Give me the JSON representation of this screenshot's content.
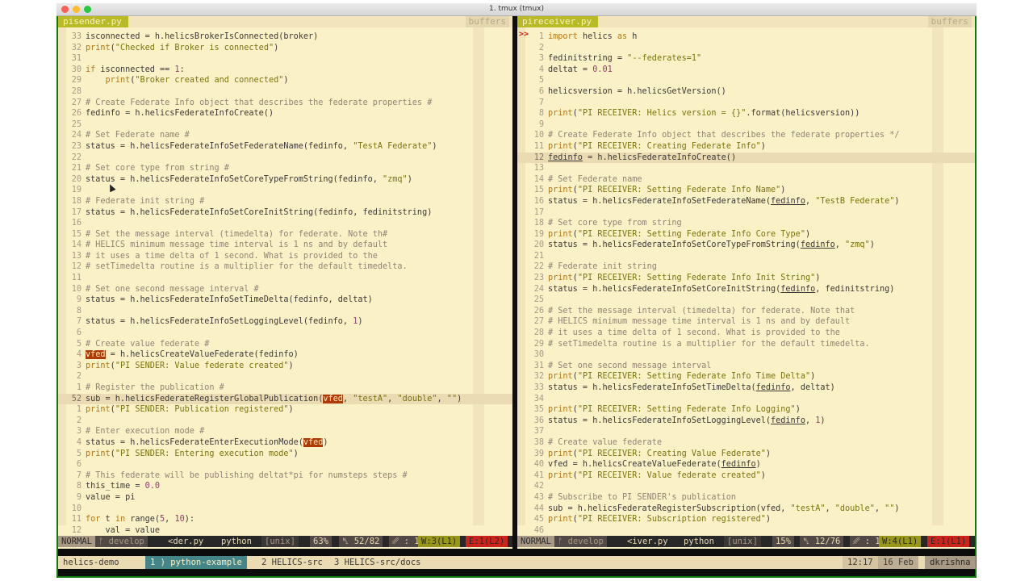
{
  "window": {
    "title": "1. tmux (tmux)"
  },
  "left_pane": {
    "file_tab": "pisender.py",
    "buffers_label": "buffers",
    "lines": [
      {
        "n": "33",
        "t": "isconnected = h.helicsBrokerIsConnected(broker)"
      },
      {
        "n": "32",
        "t": "print(\"Checked if Broker is connected\")"
      },
      {
        "n": "31",
        "t": ""
      },
      {
        "n": "30",
        "t": "if isconnected == 1:"
      },
      {
        "n": "29",
        "t": "    print(\"Broker created and connected\")"
      },
      {
        "n": "28",
        "t": ""
      },
      {
        "n": "27",
        "t": "# Create Federate Info object that describes the federate properties #"
      },
      {
        "n": "26",
        "t": "fedinfo = h.helicsFederateInfoCreate()"
      },
      {
        "n": "25",
        "t": ""
      },
      {
        "n": "24",
        "t": "# Set Federate name #"
      },
      {
        "n": "23",
        "t": "status = h.helicsFederateInfoSetFederateName(fedinfo, \"TestA Federate\")"
      },
      {
        "n": "22",
        "t": ""
      },
      {
        "n": "21",
        "t": "# Set core type from string #"
      },
      {
        "n": "20",
        "t": "status = h.helicsFederateInfoSetCoreTypeFromString(fedinfo, \"zmq\")"
      },
      {
        "n": "19",
        "t": ""
      },
      {
        "n": "18",
        "t": "# Federate init string #"
      },
      {
        "n": "17",
        "t": "status = h.helicsFederateInfoSetCoreInitString(fedinfo, fedinitstring)"
      },
      {
        "n": "16",
        "t": ""
      },
      {
        "n": "15",
        "t": "# Set the message interval (timedelta) for federate. Note th#"
      },
      {
        "n": "14",
        "t": "# HELICS minimum message time interval is 1 ns and by default"
      },
      {
        "n": "13",
        "t": "# it uses a time delta of 1 second. What is provided to the"
      },
      {
        "n": "12",
        "t": "# setTimedelta routine is a multiplier for the default timedelta."
      },
      {
        "n": "11",
        "t": ""
      },
      {
        "n": "10",
        "t": "# Set one second message interval #"
      },
      {
        "n": "9",
        "t": "status = h.helicsFederateInfoSetTimeDelta(fedinfo, deltat)"
      },
      {
        "n": "8",
        "t": ""
      },
      {
        "n": "7",
        "t": "status = h.helicsFederateInfoSetLoggingLevel(fedinfo, 1)"
      },
      {
        "n": "6",
        "t": ""
      },
      {
        "n": "5",
        "t": "# Create value federate #"
      },
      {
        "n": "4",
        "t": "vfed = h.helicsCreateValueFederate(fedinfo)"
      },
      {
        "n": "3",
        "t": "print(\"PI SENDER: Value federate created\")"
      },
      {
        "n": "2",
        "t": ""
      },
      {
        "n": "1",
        "t": "# Register the publication #"
      },
      {
        "n": "52",
        "t": "sub = h.helicsFederateRegisterGlobalPublication(vfed, \"testA\", \"double\", \"\")"
      },
      {
        "n": "1",
        "t": "print(\"PI SENDER: Publication registered\")"
      },
      {
        "n": "2",
        "t": ""
      },
      {
        "n": "3",
        "t": "# Enter execution mode #"
      },
      {
        "n": "4",
        "t": "status = h.helicsFederateEnterExecutionMode(vfed)"
      },
      {
        "n": "5",
        "t": "print(\"PI SENDER: Entering execution mode\")"
      },
      {
        "n": "6",
        "t": ""
      },
      {
        "n": "7",
        "t": "# This federate will be publishing deltat*pi for numsteps steps #"
      },
      {
        "n": "8",
        "t": "this_time = 0.0"
      },
      {
        "n": "9",
        "t": "value = pi"
      },
      {
        "n": "10",
        "t": ""
      },
      {
        "n": "11",
        "t": "for t in range(5, 10):"
      },
      {
        "n": "12",
        "t": "    val = value"
      }
    ],
    "status": {
      "mode": "NORMAL",
      "branch": "develop",
      "file": "<der.py",
      "filetype": "python",
      "format": "[unix]",
      "percent": "63%",
      "position": "52/82",
      "col": "1",
      "warnings": "W:3(L1)",
      "errors": "E:1(L2)"
    }
  },
  "right_pane": {
    "file_tab": "pireceiver.py",
    "buffers_label": "buffers",
    "sign_marker": ">>",
    "lines": [
      {
        "n": "1",
        "t": "import helics as h"
      },
      {
        "n": "2",
        "t": ""
      },
      {
        "n": "3",
        "t": "fedinitstring = \"--federates=1\""
      },
      {
        "n": "4",
        "t": "deltat = 0.01"
      },
      {
        "n": "5",
        "t": ""
      },
      {
        "n": "6",
        "t": "helicsversion = h.helicsGetVersion()"
      },
      {
        "n": "7",
        "t": ""
      },
      {
        "n": "8",
        "t": "print(\"PI RECEIVER: Helics version = {}\".format(helicsversion))"
      },
      {
        "n": "9",
        "t": ""
      },
      {
        "n": "10",
        "t": "# Create Federate Info object that describes the federate properties */"
      },
      {
        "n": "11",
        "t": "print(\"PI RECEIVER: Creating Federate Info\")"
      },
      {
        "n": "12",
        "t": "fedinfo = h.helicsFederateInfoCreate()"
      },
      {
        "n": "13",
        "t": ""
      },
      {
        "n": "14",
        "t": "# Set Federate name"
      },
      {
        "n": "15",
        "t": "print(\"PI RECEIVER: Setting Federate Info Name\")"
      },
      {
        "n": "16",
        "t": "status = h.helicsFederateInfoSetFederateName(fedinfo, \"TestB Federate\")"
      },
      {
        "n": "17",
        "t": ""
      },
      {
        "n": "18",
        "t": "# Set core type from string"
      },
      {
        "n": "19",
        "t": "print(\"PI RECEIVER: Setting Federate Info Core Type\")"
      },
      {
        "n": "20",
        "t": "status = h.helicsFederateInfoSetCoreTypeFromString(fedinfo, \"zmq\")"
      },
      {
        "n": "21",
        "t": ""
      },
      {
        "n": "22",
        "t": "# Federate init string"
      },
      {
        "n": "23",
        "t": "print(\"PI RECEIVER: Setting Federate Info Init String\")"
      },
      {
        "n": "24",
        "t": "status = h.helicsFederateInfoSetCoreInitString(fedinfo, fedinitstring)"
      },
      {
        "n": "25",
        "t": ""
      },
      {
        "n": "26",
        "t": "# Set the message interval (timedelta) for federate. Note that"
      },
      {
        "n": "27",
        "t": "# HELICS minimum message time interval is 1 ns and by default"
      },
      {
        "n": "28",
        "t": "# it uses a time delta of 1 second. What is provided to the"
      },
      {
        "n": "29",
        "t": "# setTimedelta routine is a multiplier for the default timedelta."
      },
      {
        "n": "30",
        "t": ""
      },
      {
        "n": "31",
        "t": "# Set one second message interval"
      },
      {
        "n": "32",
        "t": "print(\"PI RECEIVER: Setting Federate Info Time Delta\")"
      },
      {
        "n": "33",
        "t": "status = h.helicsFederateInfoSetTimeDelta(fedinfo, deltat)"
      },
      {
        "n": "34",
        "t": ""
      },
      {
        "n": "35",
        "t": "print(\"PI RECEIVER: Setting Federate Info Logging\")"
      },
      {
        "n": "36",
        "t": "status = h.helicsFederateInfoSetLoggingLevel(fedinfo, 1)"
      },
      {
        "n": "37",
        "t": ""
      },
      {
        "n": "38",
        "t": "# Create value federate"
      },
      {
        "n": "39",
        "t": "print(\"PI RECEIVER: Creating Value Federate\")"
      },
      {
        "n": "40",
        "t": "vfed = h.helicsCreateValueFederate(fedinfo)"
      },
      {
        "n": "41",
        "t": "print(\"PI RECEIVER: Value federate created\")"
      },
      {
        "n": "42",
        "t": ""
      },
      {
        "n": "43",
        "t": "# Subscribe to PI SENDER's publication"
      },
      {
        "n": "44",
        "t": "sub = h.helicsFederateRegisterSubscription(vfed, \"testA\", \"double\", \"\")"
      },
      {
        "n": "45",
        "t": "print(\"PI RECEIVER: Subscription registered\")"
      },
      {
        "n": "46",
        "t": ""
      }
    ],
    "status": {
      "mode": "NORMAL",
      "branch": "develop",
      "file": "<iver.py",
      "filetype": "python",
      "format": "[unix]",
      "percent": "15%",
      "position": "12/76",
      "col": "1",
      "warnings": "W:4(L1)",
      "errors": "E:1(L1)"
    }
  },
  "tmux": {
    "session": "helics-demo",
    "windows": [
      {
        "label": "1 ) python-example",
        "active": true
      },
      {
        "label": "2 HELICS-src",
        "active": false
      },
      {
        "label": "3 HELICS-src/docs",
        "active": false
      }
    ],
    "time": "12:17",
    "date": "16 Feb",
    "user": "dkrishna"
  },
  "colors": {
    "bg": "#fbf1c7",
    "tab_green": "#b8bb26",
    "window_border": "#0f7a12",
    "status_warning": "#98971a",
    "status_error": "#cc241d",
    "tmux_active": "#458588"
  }
}
